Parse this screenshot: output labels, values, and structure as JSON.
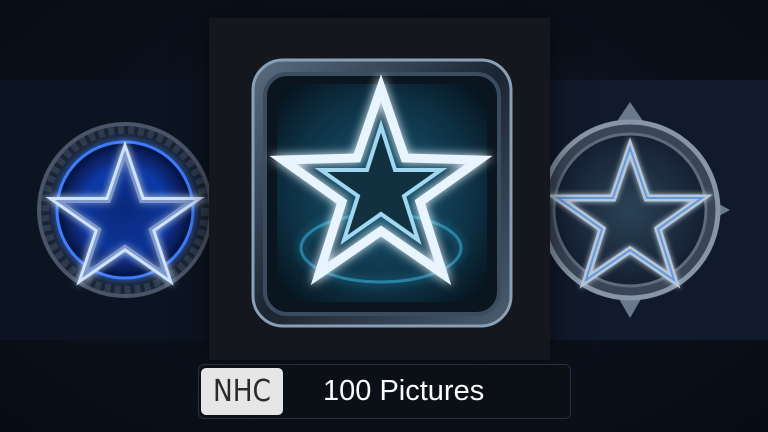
{
  "images": [
    {
      "id": "left",
      "icon": "pentagram-circular-emblem-icon",
      "accent": "#3a7bff"
    },
    {
      "id": "center",
      "icon": "star-square-app-icon",
      "accent": "#35c4ff"
    },
    {
      "id": "right",
      "icon": "pentagram-metal-ring-icon",
      "accent": "#6fa0d8"
    }
  ],
  "caption": {
    "badge": "NHC",
    "text": "100 Pictures"
  },
  "colors": {
    "background": "#0a0f1a",
    "badge_bg": "#e6e6e6",
    "text": "#ffffff"
  }
}
